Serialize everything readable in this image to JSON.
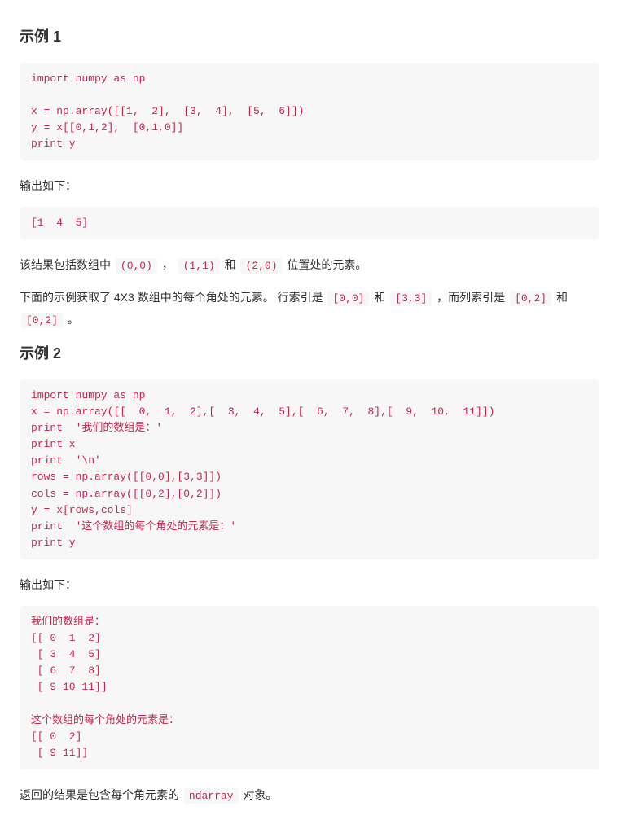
{
  "example1": {
    "heading": "示例 1",
    "code": "import numpy as np \n\nx = np.array([[1,  2],  [3,  4],  [5,  6]]) \ny = x[[0,1,2],  [0,1,0]]  \nprint y",
    "output_label": "输出如下：",
    "output": "[1  4  5]",
    "desc_prefix": "该结果包括数组中",
    "pos1": "(0,0)",
    "sep1": "，",
    "pos2": "(1,1)",
    "and": "和",
    "pos3": "(2,0)",
    "desc_suffix": "位置处的元素。",
    "para2_a": "下面的示例获取了 4X3 数组中的每个角处的元素。 行索引是",
    "row_idx1": "[0,0]",
    "para2_b": "和",
    "row_idx2": "[3,3]",
    "para2_c": "，而列索引是",
    "col_idx1": "[0,2]",
    "para2_d": "和",
    "col_idx2": "[0,2]",
    "para2_e": "。"
  },
  "example2": {
    "heading": "示例 2",
    "code": "import numpy as np \nx = np.array([[  0,  1,  2],[  3,  4,  5],[  6,  7,  8],[  9,  10,  11]])  \nprint  '我们的数组是：'  \nprint x \nprint  '\\n' \nrows = np.array([[0,0],[3,3]]) \ncols = np.array([[0,2],[0,2]]) \ny = x[rows,cols]  \nprint  '这个数组的每个角处的元素是：'  \nprint y",
    "output_label": "输出如下：",
    "output": "我们的数组是：                                                                 \n[[ 0  1  2]                                                                   \n [ 3  4  5]                                                                   \n [ 6  7  8]                                                                   \n [ 9 10 11]]\n\n这个数组的每个角处的元素是：                                      \n[[ 0  2]                                                                      \n [ 9 11]]",
    "desc_prefix": "返回的结果是包含每个角元素的",
    "ndarray": "ndarray",
    "desc_suffix": "对象。"
  }
}
